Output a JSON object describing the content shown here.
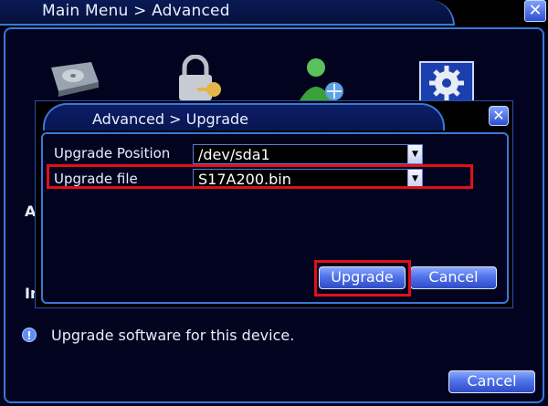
{
  "main": {
    "title": "Main Menu > Advanced",
    "close_glyph": "✕",
    "side_letter_a": "A",
    "side_letter_i": "In",
    "info_text": "Upgrade software for this device.",
    "cancel_label": "Cancel"
  },
  "icons": [
    "hdd-icon",
    "lock-key-icon",
    "user-network-icon",
    "gear-icon",
    "info-icon"
  ],
  "dialog": {
    "title": "Advanced > Upgrade",
    "close_glyph": "✕",
    "position_label": "Upgrade Position",
    "position_value": "/dev/sda1",
    "file_label": "Upgrade file",
    "file_value": "S17A200.bin",
    "upgrade_label": "Upgrade",
    "cancel_label": "Cancel"
  },
  "colors": {
    "accent": "#3a78d8",
    "highlight": "#e0101a",
    "button": "#4f73ea"
  }
}
